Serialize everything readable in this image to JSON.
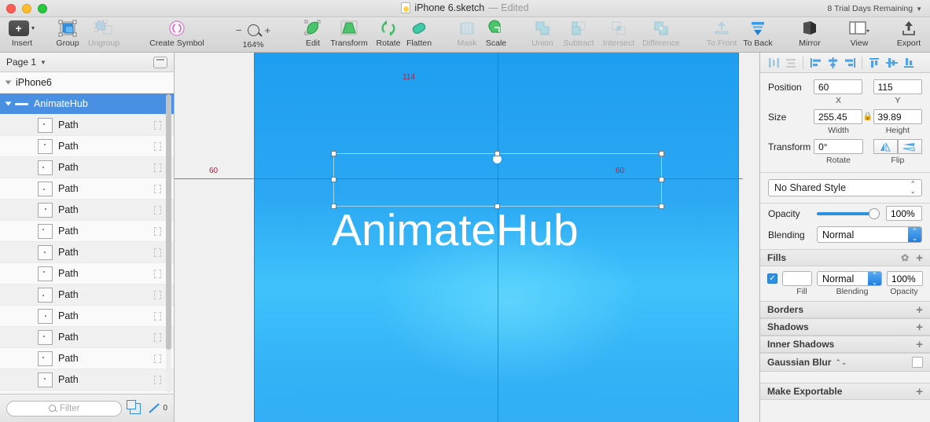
{
  "window": {
    "title": "iPhone 6.sketch",
    "edited_label": "— Edited",
    "trial": "8 Trial Days Remaining"
  },
  "toolbar": {
    "items": [
      {
        "label": "Insert",
        "icon": "plus-square-icon",
        "enabled": true
      },
      {
        "label": "Group",
        "icon": "group-icon",
        "enabled": true
      },
      {
        "label": "Ungroup",
        "icon": "ungroup-icon",
        "enabled": false
      },
      {
        "label": "Create Symbol",
        "icon": "symbol-icon",
        "enabled": true
      },
      {
        "label": "Edit",
        "icon": "edit-icon",
        "enabled": true
      },
      {
        "label": "Transform",
        "icon": "transform-icon",
        "enabled": true
      },
      {
        "label": "Rotate",
        "icon": "rotate-icon",
        "enabled": true
      },
      {
        "label": "Flatten",
        "icon": "flatten-icon",
        "enabled": true
      },
      {
        "label": "Mask",
        "icon": "mask-icon",
        "enabled": false
      },
      {
        "label": "Scale",
        "icon": "scale-icon",
        "enabled": true
      },
      {
        "label": "Union",
        "icon": "union-icon",
        "enabled": false
      },
      {
        "label": "Subtract",
        "icon": "subtract-icon",
        "enabled": false
      },
      {
        "label": "Intersect",
        "icon": "intersect-icon",
        "enabled": false
      },
      {
        "label": "Difference",
        "icon": "difference-icon",
        "enabled": false
      },
      {
        "label": "To Front",
        "icon": "to-front-icon",
        "enabled": false
      },
      {
        "label": "To Back",
        "icon": "to-back-icon",
        "enabled": true
      },
      {
        "label": "Mirror",
        "icon": "mirror-icon",
        "enabled": true
      },
      {
        "label": "View",
        "icon": "view-icon",
        "enabled": true
      },
      {
        "label": "Export",
        "icon": "export-icon",
        "enabled": true
      }
    ],
    "zoom": {
      "minus": "−",
      "plus": "+",
      "percent": "164%"
    }
  },
  "left_panel": {
    "page_name": "Page 1",
    "layers": [
      {
        "name": "iPhone6",
        "type": "artboard",
        "depth": 0,
        "selected": false
      },
      {
        "name": "AnimateHub",
        "type": "text",
        "depth": 1,
        "selected": true
      },
      {
        "name": "Path",
        "type": "path",
        "depth": 2,
        "selected": false
      },
      {
        "name": "Path",
        "type": "path",
        "depth": 2,
        "selected": false
      },
      {
        "name": "Path",
        "type": "path",
        "depth": 2,
        "selected": false
      },
      {
        "name": "Path",
        "type": "path",
        "depth": 2,
        "selected": false
      },
      {
        "name": "Path",
        "type": "path",
        "depth": 2,
        "selected": false
      },
      {
        "name": "Path",
        "type": "path",
        "depth": 2,
        "selected": false
      },
      {
        "name": "Path",
        "type": "path",
        "depth": 2,
        "selected": false
      },
      {
        "name": "Path",
        "type": "path",
        "depth": 2,
        "selected": false
      },
      {
        "name": "Path",
        "type": "path",
        "depth": 2,
        "selected": false
      },
      {
        "name": "Path",
        "type": "path",
        "depth": 2,
        "selected": false
      },
      {
        "name": "Path",
        "type": "path",
        "depth": 2,
        "selected": false
      },
      {
        "name": "Path",
        "type": "path",
        "depth": 2,
        "selected": false
      },
      {
        "name": "Path",
        "type": "path",
        "depth": 2,
        "selected": false
      }
    ],
    "filter_placeholder": "Filter",
    "pen_count": "0"
  },
  "canvas": {
    "artboard_text": "AnimateHub",
    "measurements": [
      {
        "value": "60",
        "position": "left"
      },
      {
        "value": "114",
        "position": "top"
      },
      {
        "value": "60",
        "position": "right"
      }
    ]
  },
  "inspector": {
    "position": {
      "label": "Position",
      "x": "60",
      "y": "115",
      "x_sub": "X",
      "y_sub": "Y"
    },
    "size": {
      "label": "Size",
      "width": "255.45",
      "height": "39.89",
      "width_sub": "Width",
      "height_sub": "Height",
      "lock": "lock-icon"
    },
    "transform": {
      "label": "Transform",
      "rotate": "0°",
      "rotate_sub": "Rotate",
      "flip_sub": "Flip"
    },
    "shared_style": "No Shared Style",
    "opacity": {
      "label": "Opacity",
      "value": "100%"
    },
    "blending": {
      "label": "Blending",
      "value": "Normal"
    },
    "fills": {
      "title": "Fills",
      "blending": "Normal",
      "opacity": "100%",
      "sub_fill": "Fill",
      "sub_blending": "Blending",
      "sub_opacity": "Opacity",
      "checked": true
    },
    "sections": [
      {
        "title": "Borders",
        "action": "+"
      },
      {
        "title": "Shadows",
        "action": "+"
      },
      {
        "title": "Inner Shadows",
        "action": "+"
      }
    ],
    "gaussian_blur": {
      "title": "Gaussian Blur",
      "checked": false
    },
    "make_exportable": {
      "title": "Make Exportable",
      "action": "+"
    }
  },
  "colors": {
    "accent": "#2d8fe0",
    "selection": "#4a90e2",
    "guide": "#c9414f",
    "artboard_top": "#1e9ef0",
    "artboard_glow": "#3fc2fb"
  }
}
